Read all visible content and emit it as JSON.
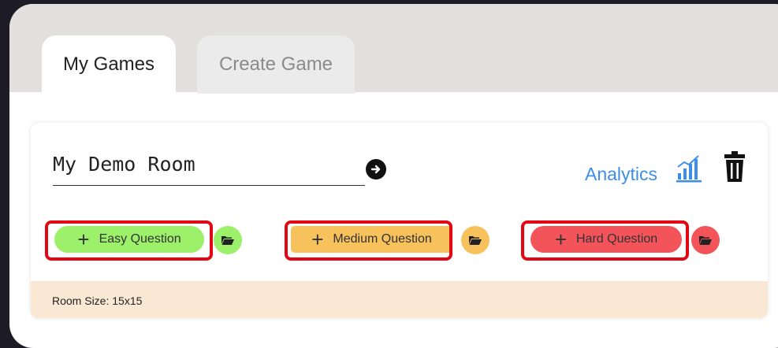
{
  "tabs": {
    "my_games": "My Games",
    "create_game": "Create Game"
  },
  "room": {
    "name": "My Demo Room",
    "analytics_label": "Analytics",
    "size_text": "Room Size: 15x15"
  },
  "questions": {
    "easy": {
      "label": "Easy Question",
      "color": "#9cf06a"
    },
    "medium": {
      "label": "Medium Question",
      "color": "#f7c15b"
    },
    "hard": {
      "label": "Hard Question",
      "color": "#f3545a"
    }
  },
  "icons": {
    "go": "arrow-right-circle-icon",
    "analytics": "signal-bars-icon",
    "delete": "trash-icon",
    "open": "folder-open-icon"
  },
  "colors": {
    "accent": "#3d8ee8",
    "highlight": "#e30613",
    "footer_bg": "#f8e8d4"
  }
}
